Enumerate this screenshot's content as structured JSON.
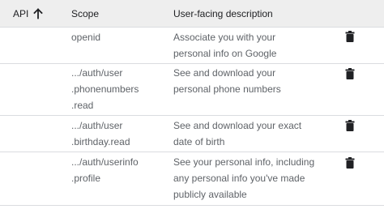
{
  "header": {
    "api_label": "API",
    "scope_label": "Scope",
    "desc_label": "User-facing description"
  },
  "rows": [
    {
      "scope": "openid",
      "description": "Associate you with your\npersonal info on Google",
      "icon": "trash-icon"
    },
    {
      "scope": ".../auth/user\n.phonenumbers\n.read",
      "description": "See and download your\npersonal phone numbers",
      "icon": "trash-icon"
    },
    {
      "scope": ".../auth/user\n.birthday.read",
      "description": "See and download your exact\ndate of birth",
      "icon": "trash-icon"
    },
    {
      "scope": ".../auth/userinfo\n.profile",
      "description": "See your personal info, including\nany personal info you've made\npublicly available",
      "icon": "trash-icon"
    }
  ]
}
